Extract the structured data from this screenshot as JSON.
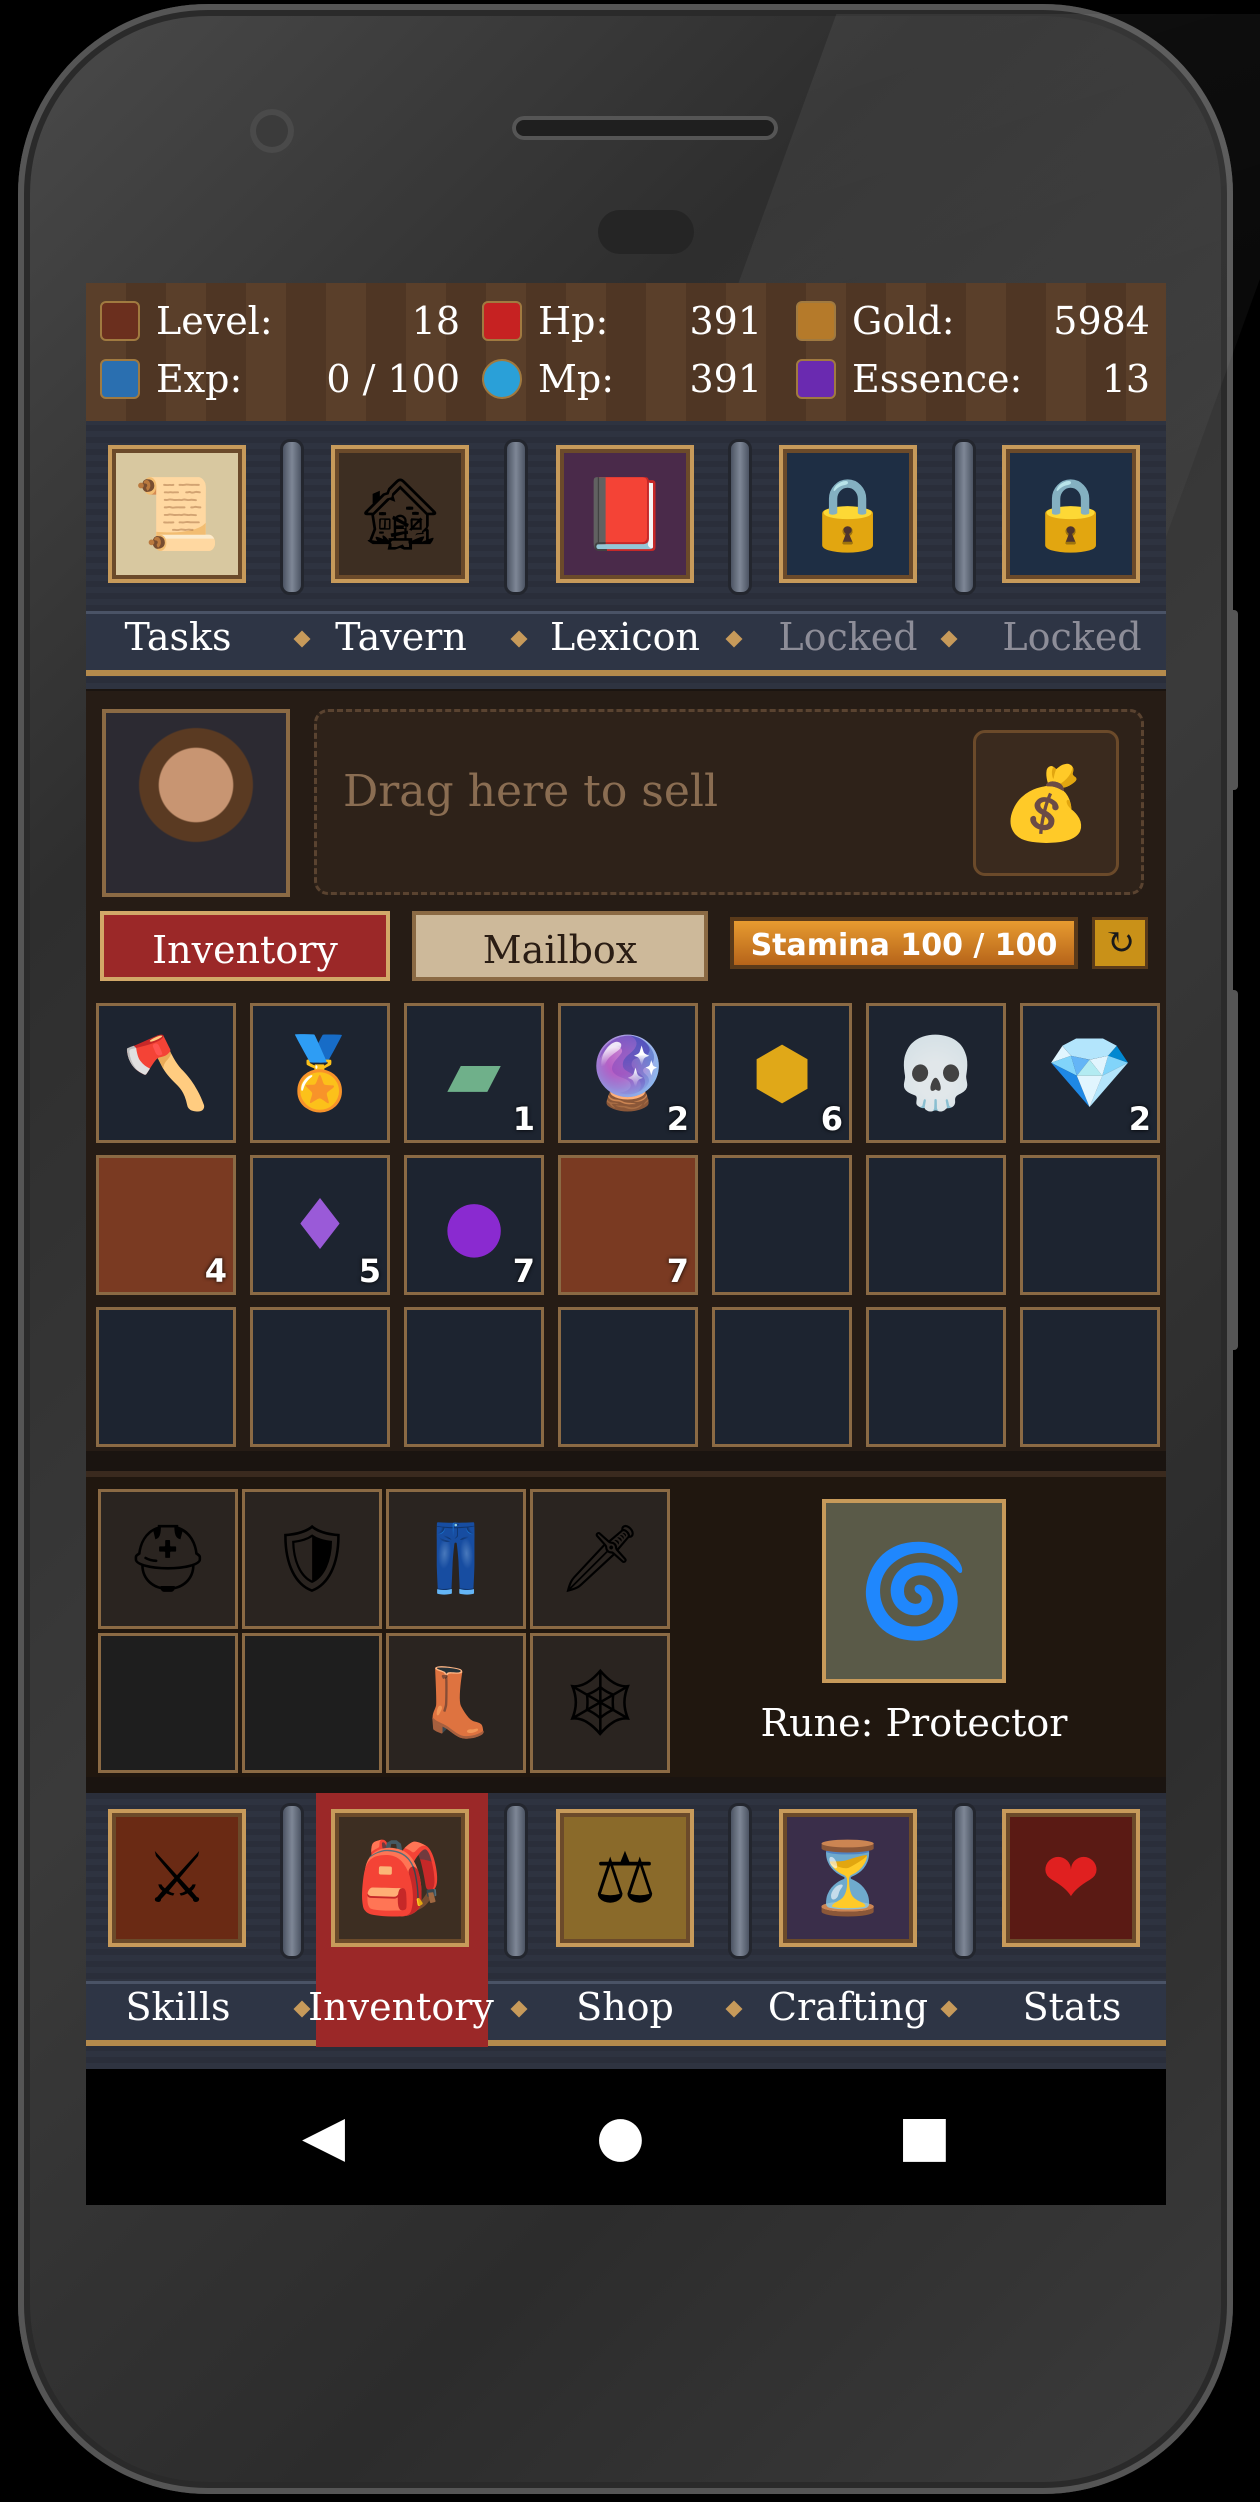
{
  "stats": [
    {
      "label": "Level:",
      "value": "18",
      "icon": "level-icon"
    },
    {
      "label": "Exp:",
      "value": "0 / 100",
      "icon": "exp-icon"
    },
    {
      "label": "Hp:",
      "value": "391",
      "icon": "heart-icon"
    },
    {
      "label": "Mp:",
      "value": "391",
      "icon": "mana-icon"
    },
    {
      "label": "Gold:",
      "value": "5984",
      "icon": "gold-icon"
    },
    {
      "label": "Essence:",
      "value": "13",
      "icon": "essence-icon"
    }
  ],
  "top_nav": [
    {
      "label": "Tasks",
      "icon": "scroll-icon",
      "locked": false
    },
    {
      "label": "Tavern",
      "icon": "tavern-wagon-icon",
      "locked": false
    },
    {
      "label": "Lexicon",
      "icon": "book-icon",
      "locked": false
    },
    {
      "label": "Locked",
      "icon": "padlock-icon",
      "locked": true
    },
    {
      "label": "Locked",
      "icon": "padlock-icon",
      "locked": true
    }
  ],
  "sell": {
    "placeholder": "Drag here to sell",
    "icon": "money-bag-icon"
  },
  "tabs": {
    "inventory": "Inventory",
    "mailbox": "Mailbox"
  },
  "stamina": "Stamina 100 / 100",
  "inventory_slots": [
    {
      "item": "battle-axe-icon",
      "count": ""
    },
    {
      "item": "gold-amulet-icon",
      "count": ""
    },
    {
      "item": "jade-ingot-icon",
      "count": "1"
    },
    {
      "item": "crystal-orb-icon",
      "count": "2"
    },
    {
      "item": "amber-gem-icon",
      "count": "6"
    },
    {
      "item": "skull-staff-icon",
      "count": ""
    },
    {
      "item": "sapphire-gem-icon",
      "count": "2"
    },
    {
      "item": "dragon-scale-icon",
      "count": "4"
    },
    {
      "item": "amethyst-crystal-icon",
      "count": "5"
    },
    {
      "item": "purple-orb-icon",
      "count": "7"
    },
    {
      "item": "dragon-scale-icon",
      "count": "7"
    }
  ],
  "equipment": [
    "helmet-icon",
    "chest-armor-icon",
    "leg-armor-icon",
    "dagger-icon",
    "empty-shoulder-icon",
    "empty-glove-icon",
    "boots-icon",
    "dreamcatcher-icon"
  ],
  "rune": {
    "label": "Rune: Protector",
    "icon": "rune-stone-icon"
  },
  "bottom_nav": [
    {
      "label": "Skills",
      "icon": "crossed-swords-icon",
      "active": false
    },
    {
      "label": "Inventory",
      "icon": "backpack-icon",
      "active": true
    },
    {
      "label": "Shop",
      "icon": "scales-icon",
      "active": false
    },
    {
      "label": "Crafting",
      "icon": "hourglass-icon",
      "active": false
    },
    {
      "label": "Stats",
      "icon": "heart-icon",
      "active": false
    }
  ],
  "colors": {
    "accent_red": "#9b2828",
    "frame_gold": "#c79a5a",
    "stamina_orange": "#e79b30"
  }
}
